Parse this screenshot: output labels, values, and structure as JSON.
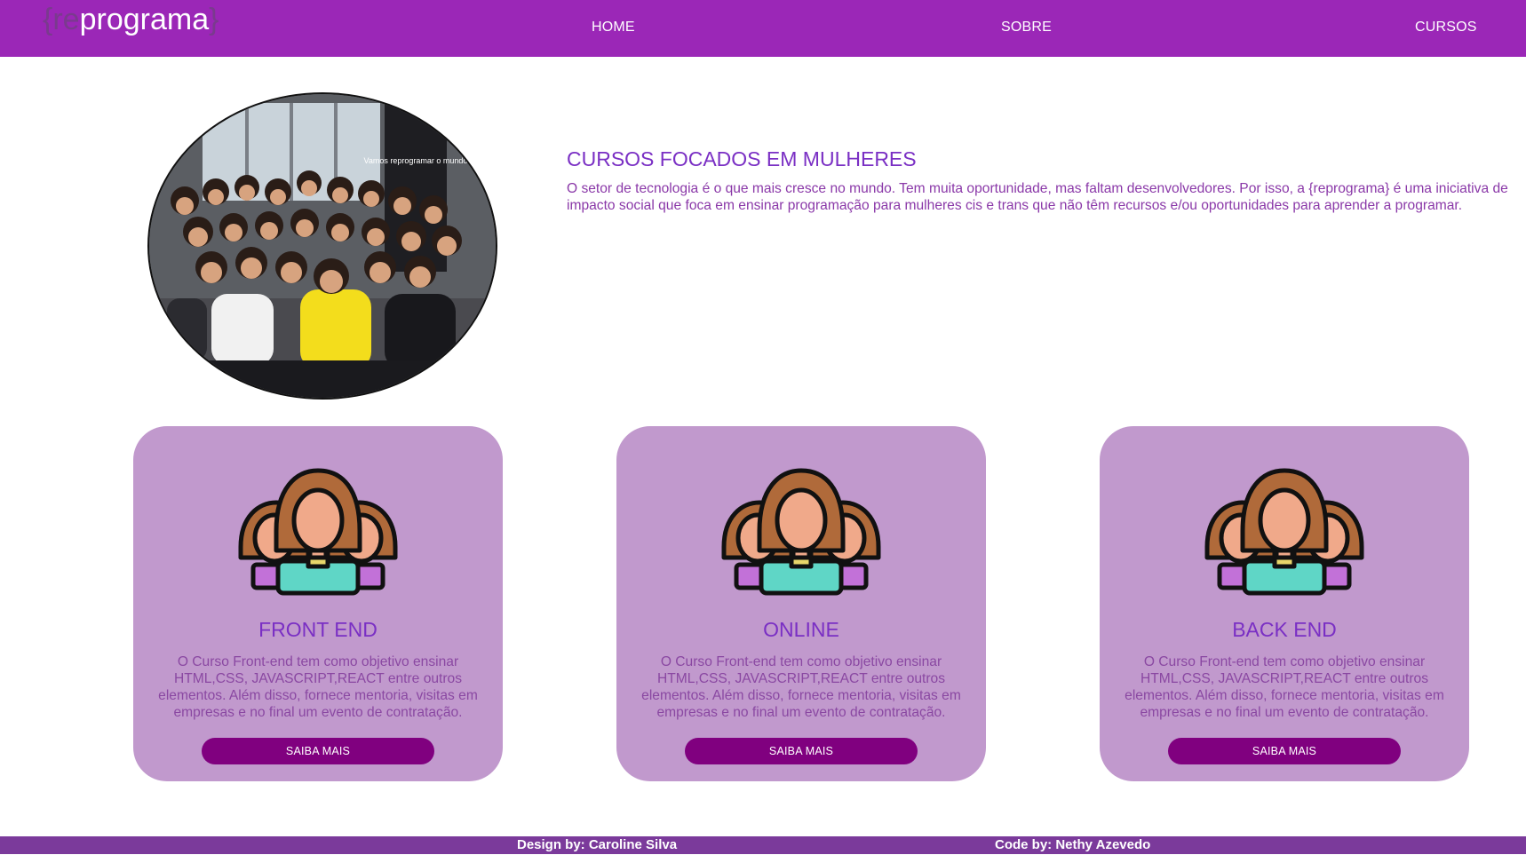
{
  "header": {
    "logo_brace_open": "{",
    "logo_prefix": "re",
    "logo_name": "programa",
    "logo_brace_close": "}",
    "nav": [
      "HOME",
      "SOBRE",
      "CURSOS"
    ]
  },
  "hero": {
    "title": "CURSOS FOCADOS EM MULHERES",
    "text": "O setor de tecnologia é o que mais cresce no mundo. Tem muita oportunidade, mas faltam desenvolvedores. Por isso, a {reprograma} é uma iniciativa de impacto social que foca em ensinar programação para mulheres cis e trans que não têm recursos e/ou oportunidades para aprender a programar.",
    "photo_sign": "Vamos reprogramar o mundo"
  },
  "cards": [
    {
      "title": "FRONT END",
      "text": "O Curso Front-end tem como objetivo ensinar HTML,CSS, JAVASCRIPT,REACT entre outros elementos. Além disso, fornece mentoria, visitas em empresas e no final um evento de contratação.",
      "button": "SAIBA MAIS"
    },
    {
      "title": "ONLINE",
      "text": "O Curso Front-end tem como objetivo ensinar HTML,CSS, JAVASCRIPT,REACT entre outros elementos. Além disso, fornece mentoria, visitas em empresas e no final um evento de contratação.",
      "button": "SAIBA MAIS"
    },
    {
      "title": "BACK END",
      "text": "O Curso Front-end tem como objetivo ensinar HTML,CSS, JAVASCRIPT,REACT entre outros elementos. Além disso, fornece mentoria, visitas em empresas e no final um evento de contratação.",
      "button": "SAIBA MAIS"
    }
  ],
  "footer": {
    "design": "Design by: Caroline Silva",
    "code": "Code by: Nethy Azevedo"
  },
  "colors": {
    "header_bg": "#9b27b7",
    "card_bg": "#c199cd",
    "button_bg": "#80007f",
    "title": "#7a2fc4",
    "footer_bg": "#7b3a9b"
  },
  "icons": [
    "women-group-icon",
    "team-photo"
  ]
}
